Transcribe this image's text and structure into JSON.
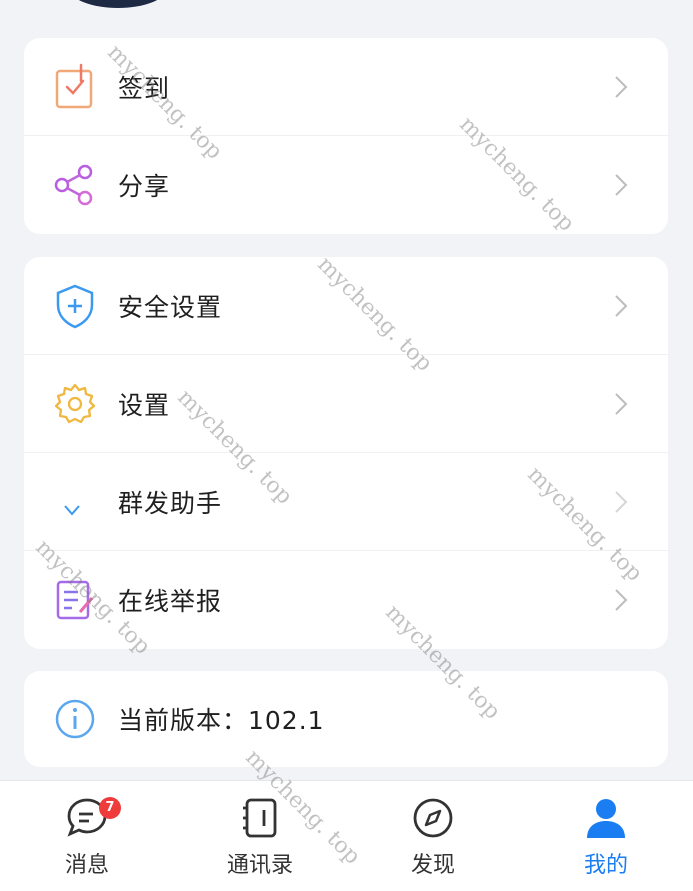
{
  "menu_group_1": [
    {
      "label": "签到",
      "icon": "checkin-icon"
    },
    {
      "label": "分享",
      "icon": "share-icon"
    }
  ],
  "menu_group_2": [
    {
      "label": "安全设置",
      "icon": "shield-icon"
    },
    {
      "label": "设置",
      "icon": "gear-icon"
    },
    {
      "label": "群发助手",
      "icon": "broadcast-icon"
    },
    {
      "label": "在线举报",
      "icon": "report-icon"
    }
  ],
  "version": {
    "label": "当前版本：102.1",
    "icon": "info-icon"
  },
  "tabbar": {
    "tabs": [
      {
        "label": "消息",
        "icon": "message-icon",
        "badge": "7"
      },
      {
        "label": "通讯录",
        "icon": "contacts-icon"
      },
      {
        "label": "发现",
        "icon": "compass-icon"
      },
      {
        "label": "我的",
        "icon": "profile-icon",
        "active": true
      }
    ]
  },
  "watermark": {
    "text": "mycheng. top"
  },
  "colors": {
    "accent": "#1a7ef2",
    "badge": "#f03b3b",
    "background": "#f2f3f7"
  }
}
